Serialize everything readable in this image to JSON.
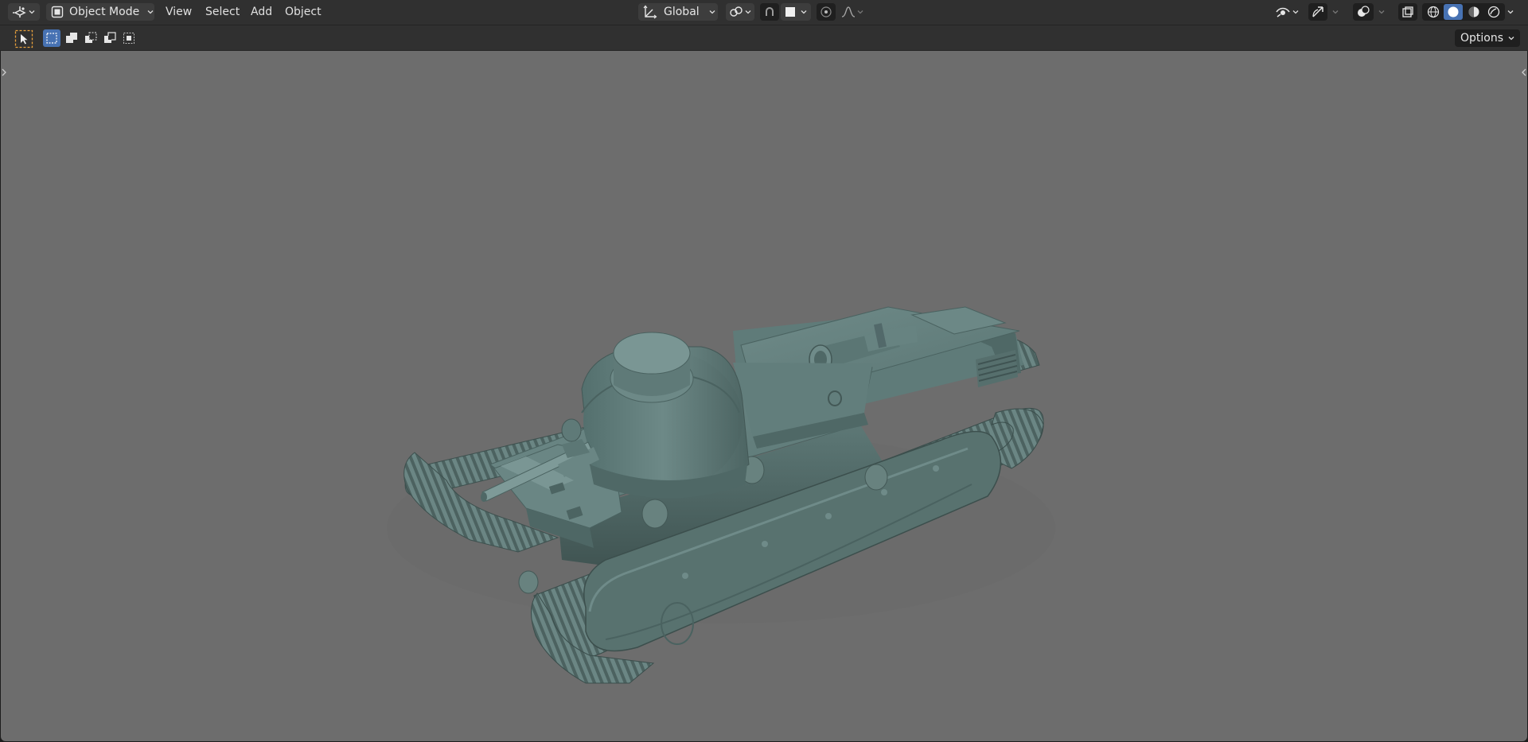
{
  "header": {
    "editor_type_icon": "camera-3d-icon",
    "mode": {
      "icon": "object-mode-icon",
      "label": "Object Mode"
    },
    "menus": [
      "View",
      "Select",
      "Add",
      "Object"
    ],
    "transform_orientation": {
      "icon": "orientation-axes-icon",
      "label": "Global"
    },
    "pivot_icon": "pivot-point-icon",
    "snap_icon": "snap-magnet-icon",
    "snap_target_icon": "snap-increment-icon",
    "proportional_icon": "proportional-edit-icon",
    "falloff_icon": "falloff-curve-icon",
    "visibility_icon": "eye-icon",
    "gizmo_icon": "gizmo-arrows-icon",
    "overlay_icon": "overlay-circles-icon",
    "xray_icon": "xray-icon",
    "shading_modes": [
      "wireframe-shading-icon",
      "solid-shading-icon",
      "material-shading-icon",
      "rendered-shading-icon"
    ],
    "active_shading": "solid-shading-icon"
  },
  "toolbar": {
    "active_tool_icon": "select-box-cursor-icon",
    "selection_modes": [
      "mode-new-icon",
      "mode-extend-icon",
      "mode-subtract-icon",
      "mode-invert-icon",
      "mode-intersect-icon"
    ],
    "options_label": "Options"
  },
  "viewport": {
    "background": "#6d6d6d",
    "model": "tank-3d-model",
    "model_color": "#56706e",
    "accent": "#4772b3"
  }
}
